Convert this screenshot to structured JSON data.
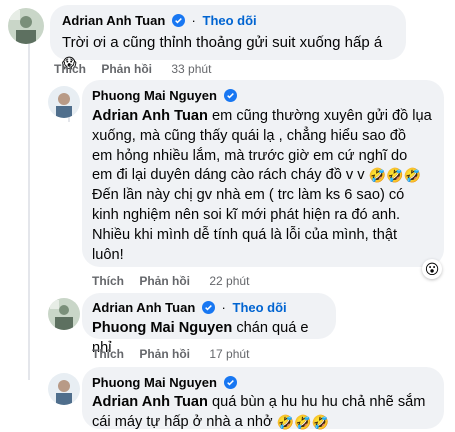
{
  "comments": [
    {
      "author": "Adrian Anh Tuan",
      "follow": "Theo dõi",
      "text": "Trời ơi a cũng thỉnh thoảng gửi suit xuống hấp á",
      "emoji": "😱",
      "actions": {
        "like": "Thích",
        "reply": "Phản hồi",
        "time": "33 phút"
      }
    },
    {
      "author": "Phuong Mai Nguyen",
      "mention": "Adrian Anh Tuan",
      "lines": [
        " em cũng thường xuyên gửi đồ lụa",
        "xuống, mà cũng thấy quái lạ , chẳng hiểu sao đồ",
        "em hỏng nhiều lắm, mà trước giờ em cứ nghĩ do",
        "em đi lại duyên dáng cào rách cháy đồ v v",
        "Đến lần này chị gv nhà em ( trc làm ks 6 sao) có",
        "kinh nghiệm nên soi kĩ mới phát hiện ra đó anh.",
        "Nhiều khi mình dễ tính quá là lỗi của mình, thật",
        "luôn!"
      ],
      "emoji": "🤣🤣🤣",
      "reaction": "😮",
      "actions": {
        "like": "Thích",
        "reply": "Phản hồi",
        "time": "22 phút"
      }
    },
    {
      "author": "Adrian Anh Tuan",
      "follow": "Theo dõi",
      "mention": "Phuong Mai Nguyen",
      "text": " chán quá e nhỉ",
      "actions": {
        "like": "Thích",
        "reply": "Phản hồi",
        "time": "17 phút"
      }
    },
    {
      "author": "Phuong Mai Nguyen",
      "mention": "Adrian Anh Tuan",
      "line1": " quá bùn ạ hu hu hu chả nhẽ sắm",
      "line2": "cái máy tự hấp ở nhà a nhở",
      "emoji": "🤣🤣🤣"
    }
  ],
  "colors": {
    "accent": "#0064d1",
    "bubble": "#f0f2f5",
    "verified": "#1877f2"
  },
  "icons": [
    "verified-badge-icon",
    "avatar"
  ]
}
